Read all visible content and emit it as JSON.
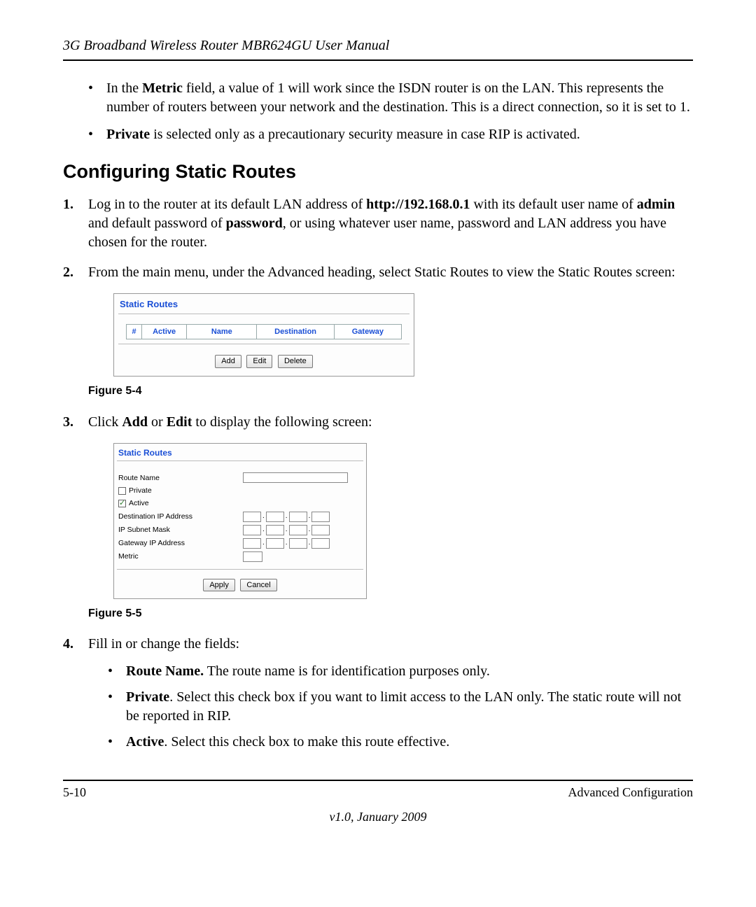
{
  "header": {
    "title": "3G Broadband Wireless Router MBR624GU User Manual"
  },
  "intro_bullets": {
    "b1_pre": "In the ",
    "b1_bold": "Metric",
    "b1_post": " field, a value of 1 will work since the ISDN router is on the LAN. This represents the number of routers between your network and the destination. This is a direct connection, so it is set to 1.",
    "b2_bold": "Private",
    "b2_post": " is selected only as a precautionary security measure in case RIP is activated."
  },
  "section": {
    "heading": "Configuring Static Routes"
  },
  "steps": {
    "s1_a": "Log in to the router at its default LAN address of ",
    "s1_url": "http://192.168.0.1",
    "s1_b": " with its default user name of ",
    "s1_admin": "admin",
    "s1_c": " and default password of ",
    "s1_password": "password",
    "s1_d": ", or using whatever user name, password and LAN address you have chosen for the router.",
    "s2": "From the main menu, under the Advanced heading, select Static Routes to view the Static Routes screen:",
    "s3_a": "Click ",
    "s3_add": "Add",
    "s3_or": " or ",
    "s3_edit": "Edit",
    "s3_b": " to display the following screen:",
    "s4": "Fill in or change the fields:"
  },
  "fig54": {
    "title": "Static Routes",
    "cols": {
      "c1": "#",
      "c2": "Active",
      "c3": "Name",
      "c4": "Destination",
      "c5": "Gateway"
    },
    "buttons": {
      "add": "Add",
      "edit": "Edit",
      "delete": "Delete"
    },
    "caption": "Figure 5-4"
  },
  "fig55": {
    "title": "Static Routes",
    "labels": {
      "route_name": "Route Name",
      "private": "Private",
      "active": "Active",
      "dest_ip": "Destination IP Address",
      "subnet": "IP Subnet Mask",
      "gateway": "Gateway IP Address",
      "metric": "Metric"
    },
    "buttons": {
      "apply": "Apply",
      "cancel": "Cancel"
    },
    "caption": "Figure 5-5"
  },
  "sub_bullets": {
    "rn_bold": "Route Name.",
    "rn_text": " The route name is for identification purposes only.",
    "pr_bold": "Private",
    "pr_text": ". Select this check box if you want to limit access to the LAN only. The static route will not be reported in RIP.",
    "ac_bold": "Active",
    "ac_text": ". Select this check box to make this route effective."
  },
  "footer": {
    "left": "5-10",
    "right": "Advanced Configuration",
    "sub": "v1.0, January 2009"
  }
}
